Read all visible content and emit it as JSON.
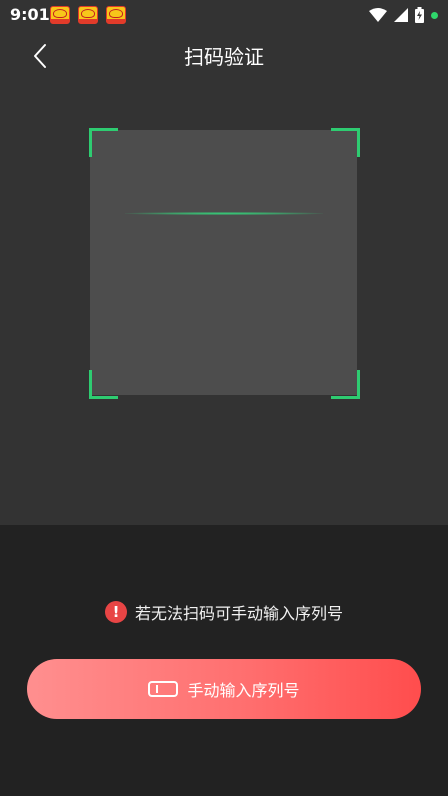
{
  "status_bar": {
    "time": "9:01",
    "icons": [
      "app-notification-icon",
      "app-notification-icon",
      "app-notification-icon",
      "wifi-icon",
      "cell-signal-icon",
      "battery-charging-icon",
      "notification-dot-icon"
    ]
  },
  "header": {
    "title": "扫码验证",
    "back_icon": "chevron-left-icon"
  },
  "scanner": {
    "frame_color": "#2ecc71",
    "scan_line_color": "#35d17a"
  },
  "hint": {
    "icon": "alert-icon",
    "icon_glyph": "!",
    "text": "若无法扫码可手动输入序列号"
  },
  "manual_button": {
    "icon": "card-icon",
    "label": "手动输入序列号",
    "gradient": [
      "#ff8f8f",
      "#ff4d4d"
    ]
  },
  "colors": {
    "top_background": "#333333",
    "bottom_background": "#222222",
    "alert": "#e84545"
  }
}
